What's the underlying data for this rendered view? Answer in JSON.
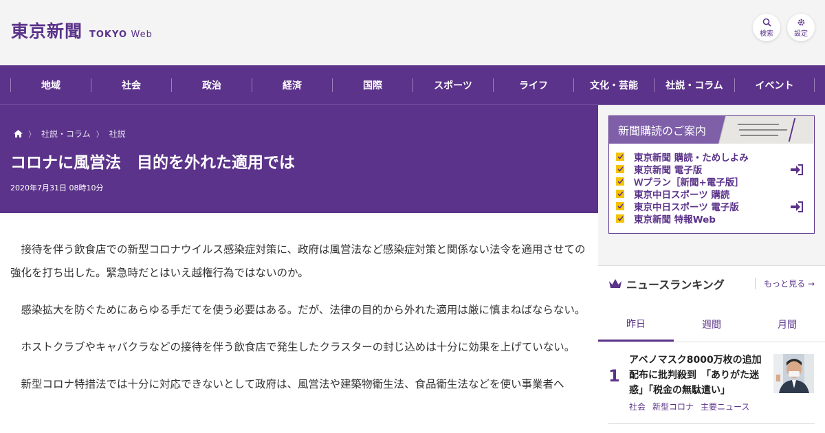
{
  "header": {
    "logo_jp": "東京新聞",
    "logo_en": "TOKYO",
    "logo_web": "Web",
    "search_label": "検索",
    "settings_label": "設定"
  },
  "nav": {
    "items": [
      "地域",
      "社会",
      "政治",
      "経済",
      "国際",
      "スポーツ",
      "ライフ",
      "文化・芸能",
      "社説・コラム",
      "イベント"
    ]
  },
  "breadcrumb": {
    "home_icon": "home-icon",
    "items": [
      "社説・コラム",
      "社説"
    ]
  },
  "article": {
    "title": "コロナに風営法　目的を外れた適用では",
    "date": "2020年7月31日 08時10分",
    "paragraphs": [
      "接待を伴う飲食店での新型コロナウイルス感染症対策に、政府は風営法など感染症対策と関係ない法令を適用させての強化を打ち出した。緊急時だとはいえ越権行為ではないのか。",
      "感染拡大を防ぐためにあらゆる手だてを使う必要はある。だが、法律の目的から外れた適用は厳に慎まねばならない。",
      "ホストクラブやキャバクラなどの接待を伴う飲食店で発生したクラスターの封じ込めは十分に効果を上げていない。",
      "新型コロナ特措法では十分に対応できないとして政府は、風営法や建築物衛生法、食品衛生法などを使い事業者へ"
    ]
  },
  "subscription": {
    "heading": "新聞購読のご案内",
    "items": [
      "東京新聞 購読・ためしよみ",
      "東京新聞 電子版",
      "Ｗプラン［新聞+電子版］",
      "東京中日スポーツ 購読",
      "東京中日スポーツ 電子版",
      "東京新聞 特報Web"
    ]
  },
  "ranking": {
    "heading": "ニュースランキング",
    "more_label": "もっと見る",
    "tabs": [
      "昨日",
      "週間",
      "月間"
    ],
    "items": [
      {
        "rank": "1",
        "title": "アベノマスク8000万枚の追加配布に批判殺到　「ありがた迷惑」「税金の無駄遣い」",
        "tags": [
          "社会",
          "新型コロナ",
          "主要ニュース"
        ]
      }
    ]
  },
  "colors": {
    "brand": "#5b338a",
    "accent_check": "#f5c400"
  }
}
